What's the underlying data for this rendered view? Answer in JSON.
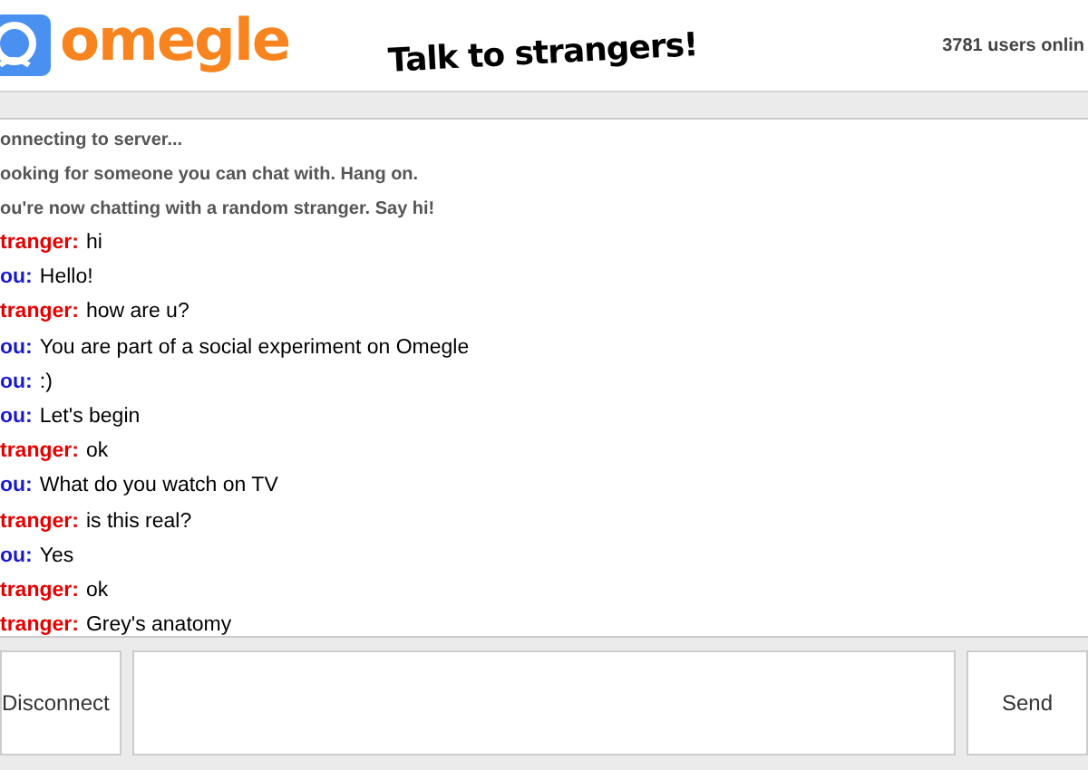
{
  "header": {
    "logo": "omegle",
    "tagline": "Talk to strangers!",
    "online_count": "3781 users onlin"
  },
  "chat": [
    {
      "kind": "system",
      "text": "onnecting to server..."
    },
    {
      "kind": "system",
      "text": "ooking for someone you can chat with. Hang on."
    },
    {
      "kind": "system",
      "text": "ou're now chatting with a random stranger. Say hi!"
    },
    {
      "kind": "message",
      "color": "#e60000",
      "name": "tranger:",
      "text": "hi"
    },
    {
      "kind": "message",
      "color": "#1a1acc",
      "name": "ou:",
      "text": "Hello!"
    },
    {
      "kind": "message",
      "color": "#e60000",
      "name": "tranger:",
      "text": "how are u?"
    },
    {
      "kind": "message",
      "color": "#1a1acc",
      "name": "ou:",
      "text": "You are part of a social experiment on Omegle"
    },
    {
      "kind": "message",
      "color": "#1a1acc",
      "name": "ou:",
      "text": ":)"
    },
    {
      "kind": "message",
      "color": "#1a1acc",
      "name": "ou:",
      "text": "Let's begin"
    },
    {
      "kind": "message",
      "color": "#e60000",
      "name": "tranger:",
      "text": "ok"
    },
    {
      "kind": "message",
      "color": "#1a1acc",
      "name": "ou:",
      "text": "What do you watch on TV"
    },
    {
      "kind": "message",
      "color": "#e60000",
      "name": "tranger:",
      "text": "is this real?"
    },
    {
      "kind": "message",
      "color": "#1a1acc",
      "name": "ou:",
      "text": "Yes"
    },
    {
      "kind": "message",
      "color": "#e60000",
      "name": "tranger:",
      "text": "ok"
    },
    {
      "kind": "message",
      "color": "#e60000",
      "name": "tranger:",
      "text": "Grey's anatomy"
    }
  ],
  "controls": {
    "disconnect": "Disconnect",
    "send": "Send"
  }
}
